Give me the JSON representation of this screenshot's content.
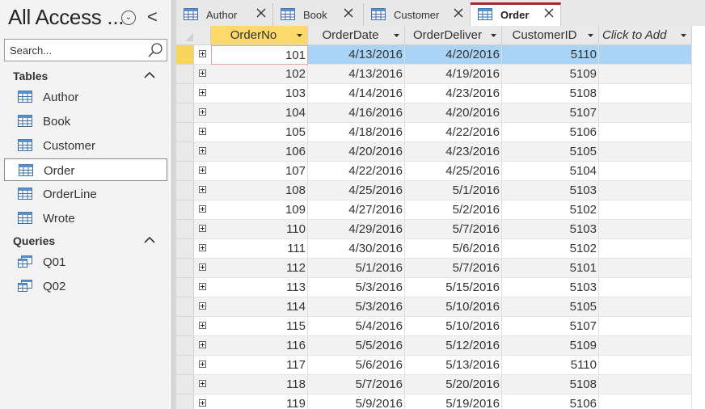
{
  "nav": {
    "title": "All Access ...",
    "menu_glyph": "⌄",
    "collapse_glyph": "<",
    "search_placeholder": "Search...",
    "groups": [
      {
        "label": "Tables",
        "items": [
          {
            "label": "Author",
            "icon": "table-icon"
          },
          {
            "label": "Book",
            "icon": "table-icon"
          },
          {
            "label": "Customer",
            "icon": "table-icon"
          },
          {
            "label": "Order",
            "icon": "table-icon",
            "selected": true
          },
          {
            "label": "OrderLine",
            "icon": "table-icon"
          },
          {
            "label": "Wrote",
            "icon": "table-icon"
          }
        ]
      },
      {
        "label": "Queries",
        "items": [
          {
            "label": "Q01",
            "icon": "query-icon"
          },
          {
            "label": "Q02",
            "icon": "query-icon"
          }
        ]
      }
    ]
  },
  "tabs": [
    {
      "label": "Author",
      "active": false
    },
    {
      "label": "Book",
      "active": false
    },
    {
      "label": "Customer",
      "active": false
    },
    {
      "label": "Order",
      "active": true
    }
  ],
  "datasheet": {
    "columns": [
      {
        "label": "OrderNo",
        "sorted": true
      },
      {
        "label": "OrderDate"
      },
      {
        "label": "OrderDeliver"
      },
      {
        "label": "CustomerID"
      },
      {
        "label": "Click to Add",
        "add": true
      }
    ],
    "current_row": 0,
    "rows": [
      [
        "101",
        "4/13/2016",
        "4/20/2016",
        "5110"
      ],
      [
        "102",
        "4/13/2016",
        "4/19/2016",
        "5109"
      ],
      [
        "103",
        "4/14/2016",
        "4/23/2016",
        "5108"
      ],
      [
        "104",
        "4/16/2016",
        "4/20/2016",
        "5107"
      ],
      [
        "105",
        "4/18/2016",
        "4/22/2016",
        "5106"
      ],
      [
        "106",
        "4/20/2016",
        "4/23/2016",
        "5105"
      ],
      [
        "107",
        "4/22/2016",
        "4/25/2016",
        "5104"
      ],
      [
        "108",
        "4/25/2016",
        "5/1/2016",
        "5103"
      ],
      [
        "109",
        "4/27/2016",
        "5/2/2016",
        "5102"
      ],
      [
        "110",
        "4/29/2016",
        "5/7/2016",
        "5103"
      ],
      [
        "111",
        "4/30/2016",
        "5/6/2016",
        "5102"
      ],
      [
        "112",
        "5/1/2016",
        "5/7/2016",
        "5101"
      ],
      [
        "113",
        "5/3/2016",
        "5/15/2016",
        "5103"
      ],
      [
        "114",
        "5/3/2016",
        "5/10/2016",
        "5105"
      ],
      [
        "115",
        "5/4/2016",
        "5/10/2016",
        "5107"
      ],
      [
        "116",
        "5/5/2016",
        "5/12/2016",
        "5109"
      ],
      [
        "117",
        "5/6/2016",
        "5/13/2016",
        "5110"
      ],
      [
        "118",
        "5/7/2016",
        "5/20/2016",
        "5108"
      ],
      [
        "119",
        "5/9/2016",
        "5/19/2016",
        "5106"
      ]
    ]
  },
  "colors": {
    "accent_tab": "#a4262c",
    "sorted_header": "#fcd96a",
    "selected_row": "#aad4f5"
  }
}
